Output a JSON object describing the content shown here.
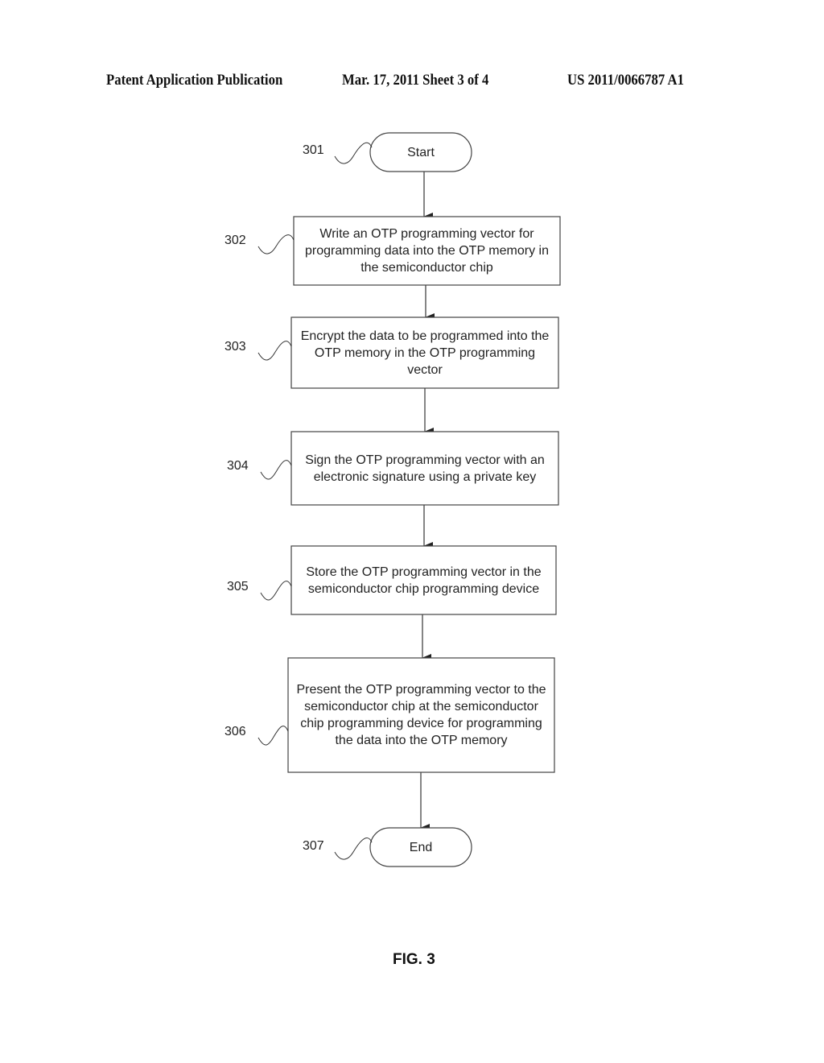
{
  "header": {
    "publication_type": "Patent Application Publication",
    "date_sheet": "Mar. 17, 2011  Sheet 3 of 4",
    "publication_number": "US 2011/0066787 A1"
  },
  "flowchart": {
    "nodes": [
      {
        "ref": "301",
        "shape": "terminal",
        "text": "Start"
      },
      {
        "ref": "302",
        "shape": "process",
        "text": "Write an OTP programming vector for programming data into the OTP memory in the semiconductor chip"
      },
      {
        "ref": "303",
        "shape": "process",
        "text": "Encrypt the data to be programmed into the OTP memory in the OTP programming vector"
      },
      {
        "ref": "304",
        "shape": "process",
        "text": "Sign the OTP programming vector with an electronic signature using a private key"
      },
      {
        "ref": "305",
        "shape": "process",
        "text": "Store the OTP programming vector in the semiconductor chip programming device"
      },
      {
        "ref": "306",
        "shape": "process",
        "text": "Present the OTP programming vector to the semiconductor chip at the semiconductor chip programming device for programming the data into the OTP memory"
      },
      {
        "ref": "307",
        "shape": "terminal",
        "text": "End"
      }
    ],
    "edges": [
      {
        "from": "301",
        "to": "302"
      },
      {
        "from": "302",
        "to": "303"
      },
      {
        "from": "303",
        "to": "304"
      },
      {
        "from": "304",
        "to": "305"
      },
      {
        "from": "305",
        "to": "306"
      },
      {
        "from": "306",
        "to": "307"
      }
    ]
  },
  "figure_label": "FIG. 3"
}
